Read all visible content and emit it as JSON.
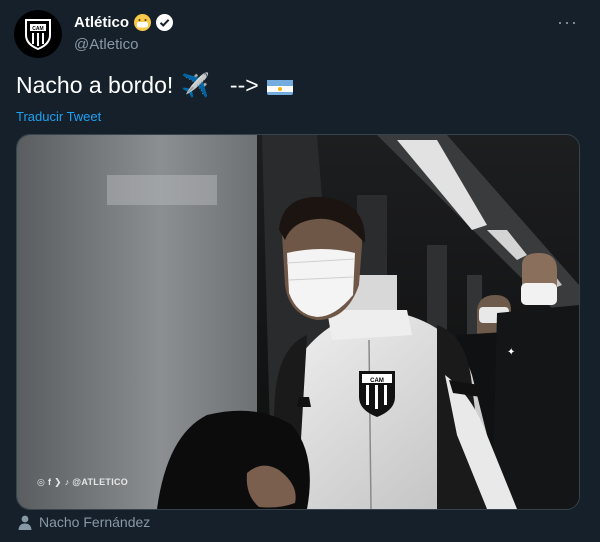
{
  "account": {
    "display_name": "Atlético",
    "handle": "@Atletico",
    "avatar_icon": "club-crest-icon",
    "verified_icon": "verified-badge-icon",
    "name_emoji": "face-with-mask-emoji"
  },
  "tweet": {
    "text": "Nacho a bordo!",
    "airplane_emoji": "✈️",
    "arrow": "-->",
    "flag_icon": "argentina-flag-icon",
    "translate_label": "Traducir Tweet"
  },
  "media": {
    "watermark": "@ATLETICO",
    "crest_text": "CAM"
  },
  "tagged_user": {
    "icon": "person-icon",
    "name": "Nacho Fernández"
  },
  "menu": {
    "icon": "more-icon",
    "glyph": "···"
  },
  "colors": {
    "background": "#15202b",
    "secondary_text": "#8899a6",
    "link": "#1da1f2"
  }
}
